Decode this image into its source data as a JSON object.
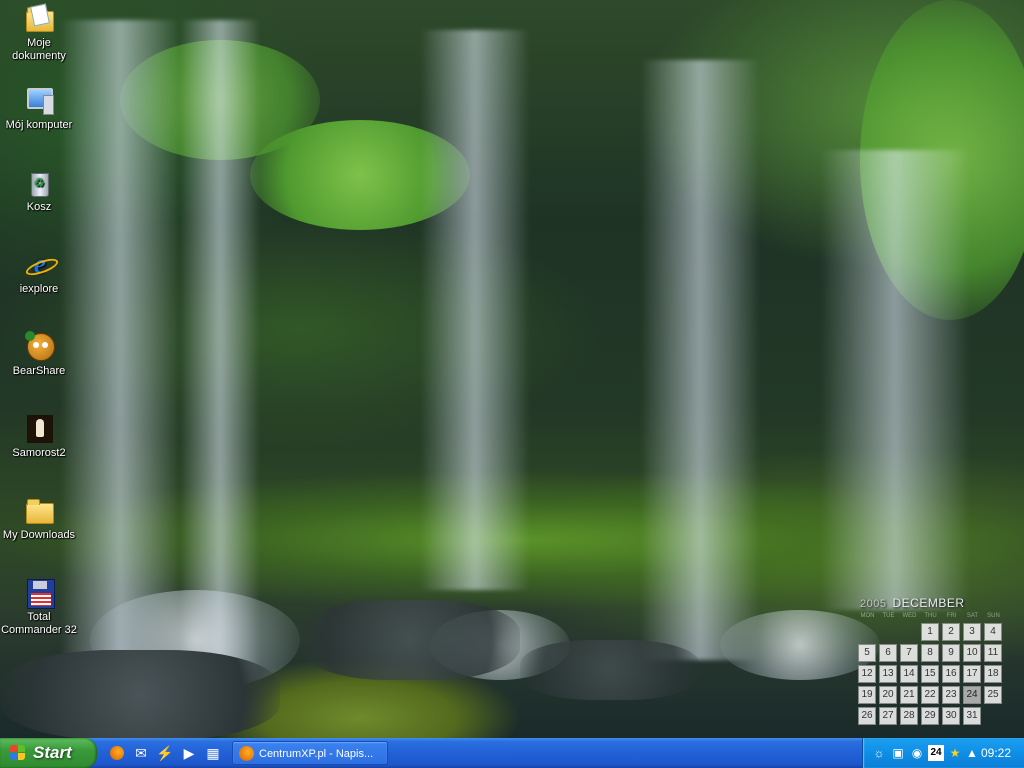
{
  "desktop_icons": [
    {
      "label": "Moje\ndokumenty",
      "icon": "my-documents-folder-icon"
    },
    {
      "label": "Mój komputer",
      "icon": "my-computer-icon"
    },
    {
      "label": "Kosz",
      "icon": "recycle-bin-icon"
    },
    {
      "label": "iexplore",
      "icon": "internet-explorer-icon"
    },
    {
      "label": "BearShare",
      "icon": "bearshare-icon"
    },
    {
      "label": "Samorost2",
      "icon": "samorost2-icon"
    },
    {
      "label": "My Downloads",
      "icon": "folder-icon"
    },
    {
      "label": "Total\nCommander 32",
      "icon": "total-commander-floppy-icon"
    }
  ],
  "calendar": {
    "year": "2005",
    "month": "DECEMBER",
    "weekdays": [
      "MON",
      "TUE",
      "WED",
      "THU",
      "FRI",
      "SAT",
      "SUN"
    ],
    "days": [
      "1",
      "2",
      "3",
      "4",
      "5",
      "6",
      "7",
      "8",
      "9",
      "10",
      "11",
      "12",
      "13",
      "14",
      "15",
      "16",
      "17",
      "18",
      "19",
      "20",
      "21",
      "22",
      "23",
      "24",
      "25",
      "26",
      "27",
      "28",
      "29",
      "30",
      "31"
    ],
    "first_weekday_index": 3,
    "today": "24"
  },
  "taskbar": {
    "start_label": "Start",
    "quick_launch": [
      {
        "icon": "firefox-icon"
      },
      {
        "icon": "outlook-express-icon"
      },
      {
        "icon": "winamp-icon"
      },
      {
        "icon": "media-player-icon"
      },
      {
        "icon": "notepad-icon"
      }
    ],
    "task": {
      "label": "CentrumXP.pl - Napis...",
      "icon": "firefox-icon"
    },
    "tray": {
      "icons": [
        "network-icon",
        "messenger-icon",
        "sound-icon",
        "calendar-24-icon",
        "star-icon",
        "shield-icon"
      ],
      "calendar_badge": "24",
      "clock": "09:22"
    }
  },
  "colors": {
    "taskbar_blue": "#2360d6",
    "start_green": "#3a9a3a",
    "tray_blue": "#0f8ee6"
  }
}
